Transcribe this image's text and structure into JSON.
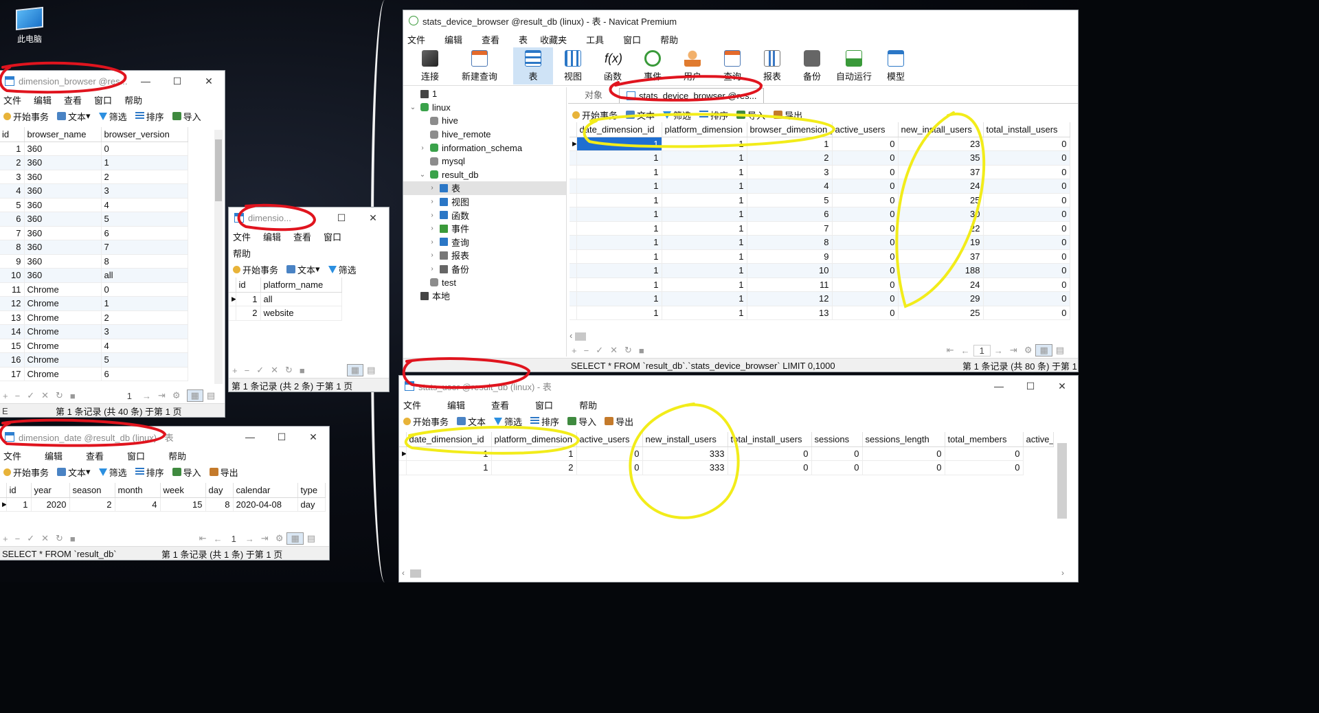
{
  "desktop": {
    "pc_icon_label": "此电脑"
  },
  "browser_window": {
    "title": "dimension_browser @res...",
    "menu": [
      "文件",
      "编辑",
      "查看",
      "窗口",
      "帮助"
    ],
    "toolbar": {
      "begin": "开始事务",
      "text": "文本",
      "filter": "筛选",
      "sort": "排序",
      "import": "导入"
    },
    "columns": [
      "id",
      "browser_name",
      "browser_version"
    ],
    "rows": [
      [
        "1",
        "360",
        "0"
      ],
      [
        "2",
        "360",
        "1"
      ],
      [
        "3",
        "360",
        "2"
      ],
      [
        "4",
        "360",
        "3"
      ],
      [
        "5",
        "360",
        "4"
      ],
      [
        "6",
        "360",
        "5"
      ],
      [
        "7",
        "360",
        "6"
      ],
      [
        "8",
        "360",
        "7"
      ],
      [
        "9",
        "360",
        "8"
      ],
      [
        "10",
        "360",
        "all"
      ],
      [
        "11",
        "Chrome",
        "0"
      ],
      [
        "12",
        "Chrome",
        "1"
      ],
      [
        "13",
        "Chrome",
        "2"
      ],
      [
        "14",
        "Chrome",
        "3"
      ],
      [
        "15",
        "Chrome",
        "4"
      ],
      [
        "16",
        "Chrome",
        "5"
      ],
      [
        "17",
        "Chrome",
        "6"
      ]
    ],
    "page": "1",
    "status": "第 1 条记录 (共 40 条) 于第 1 页"
  },
  "platform_window": {
    "title": "dimensio...",
    "menu": [
      "文件",
      "编辑",
      "查看",
      "窗口",
      "帮助"
    ],
    "toolbar": {
      "begin": "开始事务",
      "text": "文本",
      "filter": "筛选"
    },
    "columns": [
      "id",
      "platform_name"
    ],
    "rows": [
      [
        "1",
        "all"
      ],
      [
        "2",
        "website"
      ]
    ],
    "status": "第 1 条记录 (共 2 条) 于第 1 页"
  },
  "date_window": {
    "title": "dimension_date @result_db (linux) - 表",
    "menu": [
      "文件",
      "编辑",
      "查看",
      "窗口",
      "帮助"
    ],
    "toolbar": {
      "begin": "开始事务",
      "text": "文本",
      "filter": "筛选",
      "sort": "排序",
      "import": "导入",
      "export": "导出"
    },
    "columns": [
      "id",
      "year",
      "season",
      "month",
      "week",
      "day",
      "calendar",
      "type"
    ],
    "rows": [
      [
        "1",
        "2020",
        "2",
        "4",
        "15",
        "8",
        "2020-04-08",
        "day"
      ]
    ],
    "page": "1",
    "sql": "SELECT * FROM `result_db`",
    "status": "第 1 条记录 (共 1 条) 于第 1 页"
  },
  "navicat": {
    "title": "stats_device_browser @result_db (linux) - 表 - Navicat Premium",
    "menu": [
      "文件",
      "编辑",
      "查看",
      "表",
      "收藏夹",
      "工具",
      "窗口",
      "帮助"
    ],
    "ribbon": [
      "连接",
      "新建查询",
      "表",
      "视图",
      "函数",
      "事件",
      "用户",
      "查询",
      "报表",
      "备份",
      "自动运行",
      "模型"
    ],
    "tree": [
      {
        "label": "1",
        "level": 0,
        "arrow": "",
        "icon": "conn"
      },
      {
        "label": "linux",
        "level": 0,
        "arrow": "⌄",
        "icon": "db"
      },
      {
        "label": "hive",
        "level": 1,
        "arrow": "",
        "icon": "dbg"
      },
      {
        "label": "hive_remote",
        "level": 1,
        "arrow": "",
        "icon": "dbg"
      },
      {
        "label": "information_schema",
        "level": 1,
        "arrow": "›",
        "icon": "db"
      },
      {
        "label": "mysql",
        "level": 1,
        "arrow": "",
        "icon": "dbg"
      },
      {
        "label": "result_db",
        "level": 1,
        "arrow": "⌄",
        "icon": "db"
      },
      {
        "label": "表",
        "level": 2,
        "arrow": "›",
        "icon": "tbl"
      },
      {
        "label": "视图",
        "level": 2,
        "arrow": "›",
        "icon": "tbl"
      },
      {
        "label": "函数",
        "level": 2,
        "arrow": "›",
        "icon": "fx"
      },
      {
        "label": "事件",
        "level": 2,
        "arrow": "›",
        "icon": "ev"
      },
      {
        "label": "查询",
        "level": 2,
        "arrow": "›",
        "icon": "tbl"
      },
      {
        "label": "报表",
        "level": 2,
        "arrow": "›",
        "icon": "rep"
      },
      {
        "label": "备份",
        "level": 2,
        "arrow": "›",
        "icon": "bak"
      },
      {
        "label": "test",
        "level": 1,
        "arrow": "",
        "icon": "dbg"
      },
      {
        "label": "本地",
        "level": 0,
        "arrow": "",
        "icon": "conn"
      }
    ],
    "tabs": {
      "objects": "对象",
      "active": "stats_device_browser @res..."
    },
    "toolbar": {
      "begin": "开始事务",
      "text": "文本",
      "filter": "筛选",
      "sort": "排序",
      "import": "导入",
      "export": "导出"
    },
    "columns": [
      "date_dimension_id",
      "platform_dimension",
      "browser_dimension_id",
      "active_users",
      "new_install_users",
      "total_install_users"
    ],
    "rows": [
      [
        "1",
        "1",
        "1",
        "0",
        "23",
        "0"
      ],
      [
        "1",
        "1",
        "2",
        "0",
        "35",
        "0"
      ],
      [
        "1",
        "1",
        "3",
        "0",
        "37",
        "0"
      ],
      [
        "1",
        "1",
        "4",
        "0",
        "24",
        "0"
      ],
      [
        "1",
        "1",
        "5",
        "0",
        "25",
        "0"
      ],
      [
        "1",
        "1",
        "6",
        "0",
        "30",
        "0"
      ],
      [
        "1",
        "1",
        "7",
        "0",
        "22",
        "0"
      ],
      [
        "1",
        "1",
        "8",
        "0",
        "19",
        "0"
      ],
      [
        "1",
        "1",
        "9",
        "0",
        "37",
        "0"
      ],
      [
        "1",
        "1",
        "10",
        "0",
        "188",
        "0"
      ],
      [
        "1",
        "1",
        "11",
        "0",
        "24",
        "0"
      ],
      [
        "1",
        "1",
        "12",
        "0",
        "29",
        "0"
      ],
      [
        "1",
        "1",
        "13",
        "0",
        "25",
        "0"
      ]
    ],
    "page": "1",
    "sql": "SELECT * FROM `result_db`.`stats_device_browser` LIMIT 0,1000",
    "status": "第 1 条记录 (共 80 条) 于第 1"
  },
  "user_window": {
    "title": "stats_user @result_db (linux) - 表",
    "menu": [
      "文件",
      "编辑",
      "查看",
      "窗口",
      "帮助"
    ],
    "toolbar": {
      "begin": "开始事务",
      "text": "文本",
      "filter": "筛选",
      "sort": "排序",
      "import": "导入",
      "export": "导出"
    },
    "columns": [
      "date_dimension_id",
      "platform_dimension",
      "active_users",
      "new_install_users",
      "total_install_users",
      "sessions",
      "sessions_length",
      "total_members",
      "active_"
    ],
    "rows": [
      [
        "1",
        "1",
        "0",
        "333",
        "0",
        "0",
        "0",
        "0"
      ],
      [
        "1",
        "2",
        "0",
        "333",
        "0",
        "0",
        "0",
        "0"
      ]
    ]
  }
}
